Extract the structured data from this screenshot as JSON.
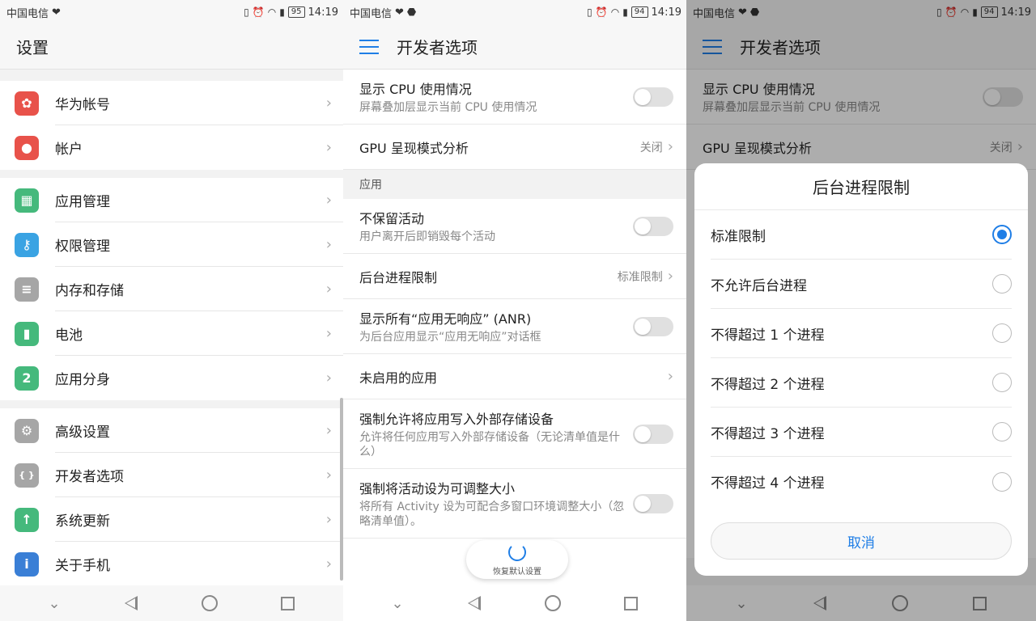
{
  "status": {
    "carrier": "中国电信",
    "time": "14:19",
    "battery_s1": "95",
    "battery_s2": "94",
    "battery_s3": "94"
  },
  "settings": {
    "title": "设置",
    "groups": [
      [
        {
          "label": "华为帐号",
          "icon": "huawei-icon",
          "color": "#e8524a"
        },
        {
          "label": "帐户",
          "icon": "account-icon",
          "color": "#e8524a"
        }
      ],
      [
        {
          "label": "应用管理",
          "icon": "apps-icon",
          "color": "#45b97c"
        },
        {
          "label": "权限管理",
          "icon": "key-icon",
          "color": "#3aa3e3"
        },
        {
          "label": "内存和存储",
          "icon": "storage-icon",
          "color": "#a6a6a6"
        },
        {
          "label": "电池",
          "icon": "battery-icon",
          "color": "#45b97c"
        },
        {
          "label": "应用分身",
          "icon": "clone-icon",
          "color": "#45b97c"
        }
      ],
      [
        {
          "label": "高级设置",
          "icon": "gear-icon",
          "color": "#a6a6a6"
        },
        {
          "label": "开发者选项",
          "icon": "braces-icon",
          "color": "#a6a6a6"
        },
        {
          "label": "系统更新",
          "icon": "update-icon",
          "color": "#45b97c"
        },
        {
          "label": "关于手机",
          "icon": "info-icon",
          "color": "#3a7fd6"
        }
      ]
    ]
  },
  "dev": {
    "title": "开发者选项",
    "rows_top": [
      {
        "title": "显示 CPU 使用情况",
        "sub": "屏幕叠加层显示当前 CPU 使用情况",
        "type": "toggle"
      },
      {
        "title": "GPU 呈现模式分析",
        "value": "关闭",
        "type": "value"
      }
    ],
    "section": "应用",
    "rows_app": [
      {
        "title": "不保留活动",
        "sub": "用户离开后即销毁每个活动",
        "type": "toggle"
      },
      {
        "title": "后台进程限制",
        "value": "标准限制",
        "type": "value"
      },
      {
        "title": "显示所有“应用无响应” (ANR)",
        "sub": "为后台应用显示“应用无响应”对话框",
        "type": "toggle"
      },
      {
        "title": "未启用的应用",
        "type": "chevron"
      },
      {
        "title": "强制允许将应用写入外部存储设备",
        "sub": "允许将任何应用写入外部存储设备（无论清单值是什么）",
        "type": "toggle"
      },
      {
        "title": "强制将活动设为可调整大小",
        "sub": "将所有 Activity 设为可配合多窗口环境调整大小（忽略清单值）。",
        "type": "toggle"
      }
    ],
    "restore_label": "恢复默认设置"
  },
  "dialog": {
    "title": "后台进程限制",
    "options": [
      "标准限制",
      "不允许后台进程",
      "不得超过 1 个进程",
      "不得超过 2 个进程",
      "不得超过 3 个进程",
      "不得超过 4 个进程"
    ],
    "selected": 0,
    "cancel": "取消"
  }
}
